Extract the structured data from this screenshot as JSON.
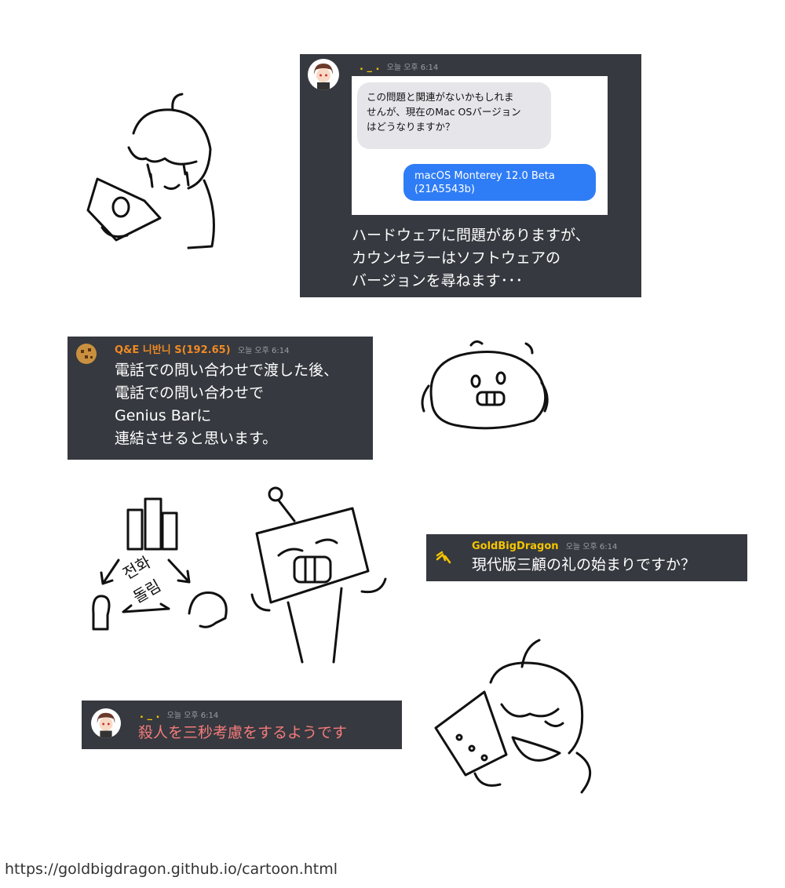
{
  "panel1": {
    "username": ". _ .",
    "timestamp": "오늘 오후 6:14",
    "bubble_left": "この問題と関連がないかもしれま\nせんが、現在のMac OSバージョン\nはどうなりますか？",
    "bubble_right": "macOS Monterey 12.0 Beta\n(21A5543b)",
    "caption": "ハードウェアに問題がありますが、\nカウンセラーはソフトウェアの\nバージョンを尋ねます･･･",
    "name_color": "#f5c400"
  },
  "panel2": {
    "username": "Q&E 니반니 S(192.65)",
    "timestamp": "오늘 오후 6:14",
    "message": "電話での問い合わせで渡した後、\n電話での問い合わせで\nGenius Barに\n連結させると思います。",
    "name_color": "#f08a24"
  },
  "panel3": {
    "username": "GoldBigDragon",
    "timestamp": "오늘 오후 6:14",
    "message": "現代版三顧の礼の始まりですか？",
    "name_color": "#f5c400"
  },
  "panel4": {
    "username": ". _ .",
    "timestamp": "오늘 오후 6:14",
    "message": "殺人を三秒考慮をするようです",
    "name_color": "#f5c400",
    "message_color": "#f47b7b"
  },
  "drawing_text": {
    "korean_call": "전화",
    "korean_turn": "돌림"
  },
  "footer_url": "https://goldbigdragon.github.io/cartoon.html"
}
